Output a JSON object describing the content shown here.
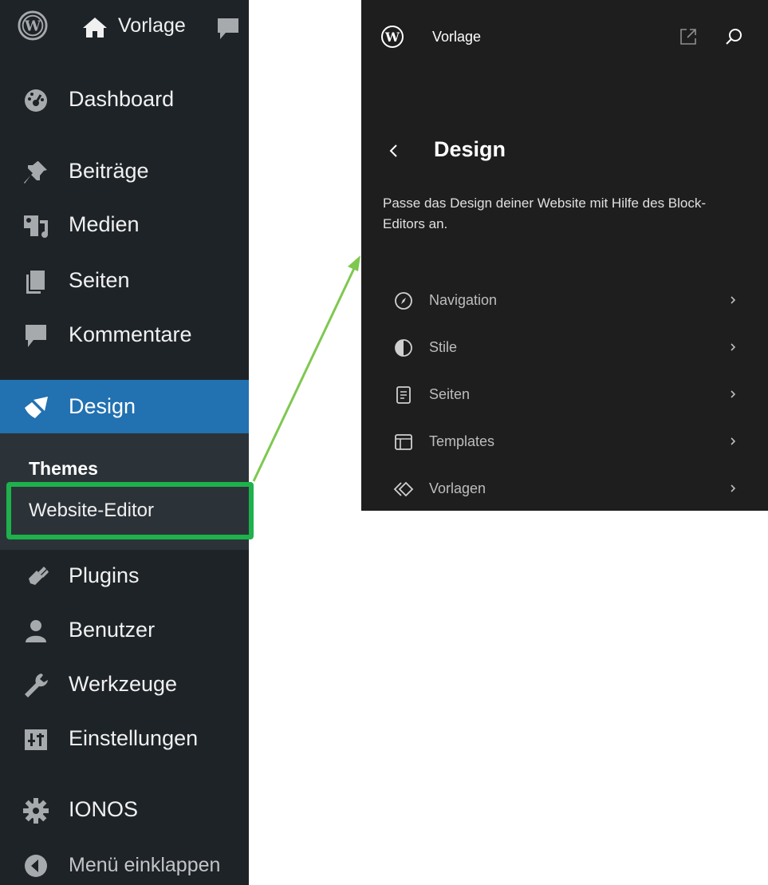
{
  "admin": {
    "site_name": "Vorlage",
    "menu": {
      "dashboard": "Dashboard",
      "posts": "Beiträge",
      "media": "Medien",
      "pages": "Seiten",
      "comments": "Kommentare",
      "design": "Design",
      "plugins": "Plugins",
      "users": "Benutzer",
      "tools": "Werkzeuge",
      "settings": "Einstellungen",
      "ionos": "IONOS",
      "collapse": "Menü einklappen"
    },
    "submenu": {
      "themes": "Themes",
      "site_editor": "Website-Editor"
    }
  },
  "editor": {
    "site_name": "Vorlage",
    "title": "Design",
    "description": "Passe das Design deiner Website mit Hilfe des Block-Editors an.",
    "nav": {
      "navigation": "Navigation",
      "styles": "Stile",
      "pages": "Seiten",
      "templates": "Templates",
      "patterns": "Vorlagen"
    }
  },
  "icons": {
    "admin_sidebar": [
      "wordpress-logo-icon",
      "home-icon",
      "comment-bubble-icon",
      "dashboard-gauge-icon",
      "pin-icon",
      "media-icon",
      "pages-icon",
      "comments-icon",
      "paintbrush-icon",
      "plugin-icon",
      "user-icon",
      "wrench-icon",
      "settings-sliders-icon",
      "gear-icon",
      "collapse-arrow-icon"
    ],
    "editor_panel": [
      "wordpress-logo-icon",
      "external-link-icon",
      "search-icon",
      "back-chevron-icon",
      "compass-icon",
      "half-circle-icon",
      "document-icon",
      "layout-icon",
      "diamond-pattern-icon",
      "chevron-right-icon"
    ]
  },
  "colors": {
    "sidebar_bg": "#1e2327",
    "active_item": "#2271b1",
    "submenu_bg": "#2c3338",
    "highlight_border": "#1db24b",
    "arrow": "#7ec850",
    "panel_bg": "#1e1e1e"
  }
}
